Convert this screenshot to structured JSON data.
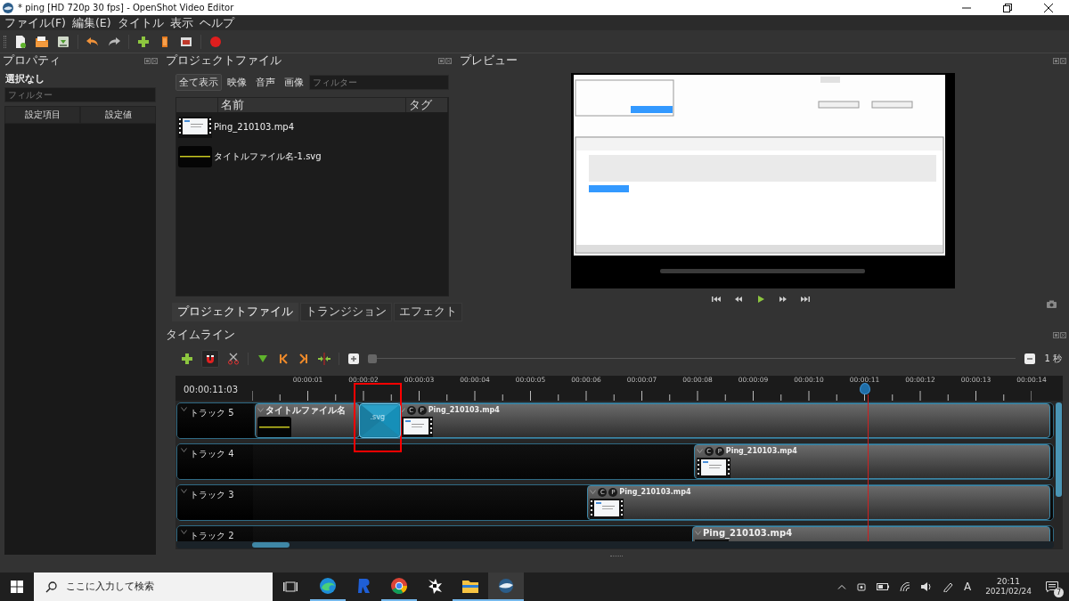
{
  "window": {
    "title": "* ping [HD 720p 30 fps] - OpenShot Video Editor"
  },
  "menu": [
    "ファイル(F)",
    "編集(E)",
    "タイトル",
    "表示",
    "ヘルプ"
  ],
  "properties": {
    "title": "プロパティ",
    "selection": "選択なし",
    "filter": {
      "placeholder": "フィルター"
    },
    "columns": [
      "設定項目",
      "設定値"
    ]
  },
  "project_files": {
    "title": "プロジェクトファイル",
    "filters": [
      {
        "label": "全て表示",
        "selected": true
      },
      {
        "label": "映像",
        "selected": false
      },
      {
        "label": "音声",
        "selected": false
      },
      {
        "label": "画像",
        "selected": false
      }
    ],
    "search": {
      "placeholder": "フィルター"
    },
    "columns": [
      "名前",
      "タグ"
    ],
    "files": [
      {
        "name": "Ping_210103.mp4",
        "kind": "video"
      },
      {
        "name": "タイトルファイル名-1.svg",
        "kind": "title"
      }
    ],
    "tabs": [
      {
        "label": "プロジェクトファイル",
        "selected": true
      },
      {
        "label": "トランジション",
        "selected": false
      },
      {
        "label": "エフェクト",
        "selected": false
      }
    ]
  },
  "preview": {
    "title": "プレビュー"
  },
  "timeline": {
    "title": "タイムライン",
    "snapping": {
      "on": true
    },
    "zoom": {
      "label": "1 秒",
      "level": 0
    },
    "current_time": "00:00:11:03",
    "ruler": [
      "00:00:01",
      "00:00:02",
      "00:00:03",
      "00:00:04",
      "00:00:05",
      "00:00:06",
      "00:00:07",
      "00:00:08",
      "00:00:09",
      "00:00:10",
      "00:00:11",
      "00:00:12",
      "00:00:13",
      "00:00:14"
    ],
    "playhead": {
      "level": 0.768
    },
    "tracks": [
      {
        "name": "トラック 5",
        "clips": [
          {
            "kind": "title",
            "name": "タイトルファイル名",
            "highlighted": false
          },
          {
            "kind": "transition",
            "name": ".svg",
            "highlighted": true
          },
          {
            "kind": "video",
            "name": "Ping_210103.mp4",
            "badges": [
              "C",
              "P"
            ],
            "highlighted": false
          }
        ]
      },
      {
        "name": "トラック 4",
        "clips": [
          {
            "kind": "video",
            "name": "Ping_210103.mp4",
            "badges": [
              "C",
              "P"
            ],
            "highlighted": false
          }
        ]
      },
      {
        "name": "トラック 3",
        "clips": [
          {
            "kind": "video",
            "name": "Ping_210103.mp4",
            "badges": [
              "C",
              "P"
            ],
            "highlighted": false
          }
        ]
      },
      {
        "name": "トラック 2",
        "clips": [
          {
            "kind": "video",
            "name": "Ping_210103.mp4",
            "highlighted": false
          }
        ]
      }
    ]
  },
  "taskbar": {
    "search": {
      "placeholder": "ここに入力して検索"
    },
    "apps": [
      {
        "kind": "wave",
        "running": true,
        "selected": false
      },
      {
        "kind": "letter",
        "running": false,
        "selected": false
      },
      {
        "kind": "ring",
        "running": true,
        "selected": false
      },
      {
        "kind": "star",
        "running": false,
        "selected": false
      },
      {
        "kind": "folder",
        "running": true,
        "selected": false
      },
      {
        "kind": "globe",
        "running": true,
        "selected": true
      }
    ],
    "ime": "A",
    "time": "20:11",
    "date": "2021/02/24",
    "notifications": "7"
  }
}
